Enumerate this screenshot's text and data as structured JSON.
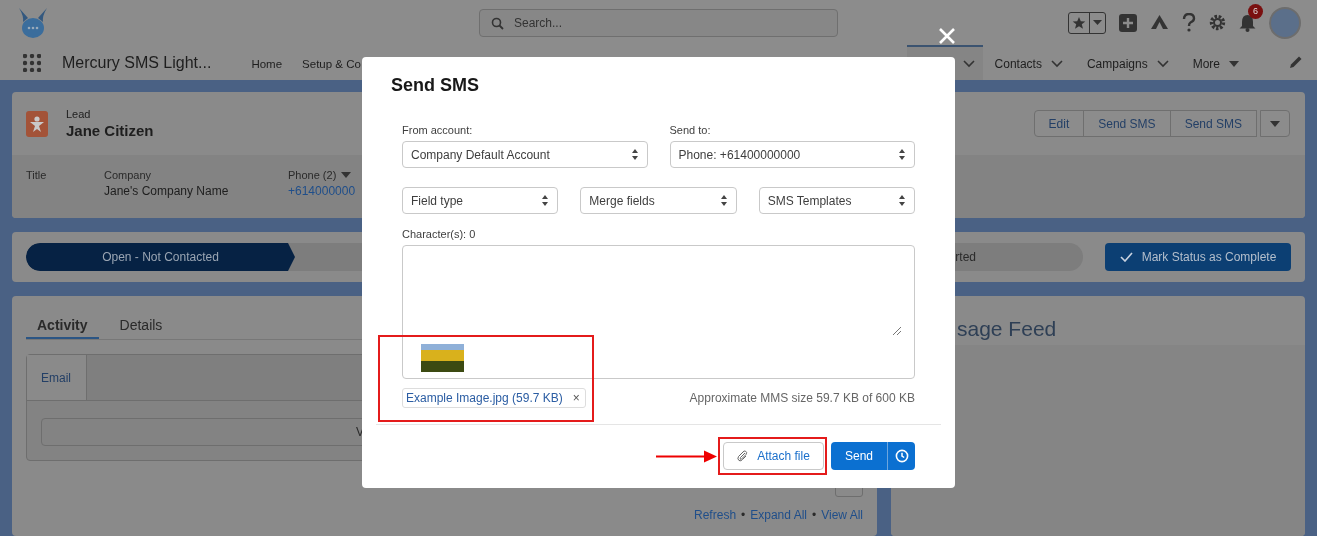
{
  "header": {
    "search": {
      "placeholder": "Search..."
    },
    "notifications": {
      "badge": "6"
    }
  },
  "nav": {
    "app_name": "Mercury SMS Light...",
    "tabs": [
      {
        "label": "Home",
        "selected": false,
        "kind": "plain"
      },
      {
        "label": "Setup & Co",
        "selected": false,
        "kind": "plain"
      },
      {
        "selected": true,
        "kind": "menu"
      },
      {
        "label": "Contacts",
        "selected": false,
        "kind": "menu"
      },
      {
        "label": "Campaigns",
        "selected": false,
        "kind": "menu"
      },
      {
        "label": "More",
        "selected": false,
        "kind": "overflow"
      }
    ]
  },
  "record": {
    "type": "Lead",
    "name": "Jane Citizen",
    "actions": [
      "Edit",
      "Send SMS",
      "Send SMS"
    ],
    "fields": [
      {
        "label": "Title",
        "kind": "text"
      },
      {
        "label": "Company",
        "value": "Jane's Company Name",
        "kind": "text"
      },
      {
        "label": "Phone (2)",
        "value": "+614000000",
        "kind": "link",
        "dropdown": true
      }
    ]
  },
  "path": {
    "stages": [
      {
        "label": "Open - Not Contacted",
        "selected": true
      },
      {
        "label": "rted",
        "selected": false
      }
    ],
    "complete_button": "Mark Status as Complete"
  },
  "activity": {
    "tabs": [
      {
        "label": "Activity",
        "selected": true
      },
      {
        "label": "Details",
        "selected": false
      }
    ],
    "composer_tabs": [
      {
        "label": "Email",
        "selected": true
      }
    ],
    "composer_field": "V",
    "links": [
      "Refresh",
      "Expand All",
      "View All"
    ],
    "separator": "•"
  },
  "feed": {
    "title": "sage Feed"
  },
  "modal": {
    "title": "Send SMS",
    "from": {
      "label": "From account:",
      "value": "Company Default Account"
    },
    "to": {
      "label": "Send to:",
      "value": "Phone: +61400000000"
    },
    "pickers": [
      "Field type",
      "Merge fields",
      "SMS Templates"
    ],
    "counter": "Character(s): 0",
    "attachments": [
      {
        "name": "Example Image.jpg (59.7 KB)",
        "remove": "×"
      }
    ],
    "size_note": "Approximate MMS size 59.7 KB of 600 KB",
    "attach_button": "Attach file",
    "send_button": "Send"
  }
}
